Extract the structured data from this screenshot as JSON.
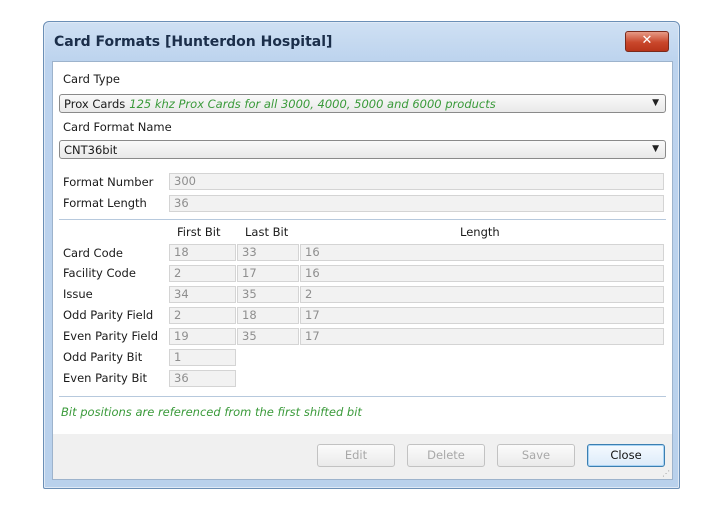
{
  "window": {
    "title": "Card Formats [Hunterdon Hospital]",
    "close_glyph": "✕"
  },
  "card_type": {
    "label": "Card Type",
    "value": "Prox Cards",
    "description": "125 khz Prox Cards for all 3000, 4000, 5000 and 6000 products"
  },
  "card_format_name": {
    "label": "Card Format Name",
    "value": "CNT36bit"
  },
  "format_number": {
    "label": "Format Number",
    "value": "300"
  },
  "format_length": {
    "label": "Format Length",
    "value": "36"
  },
  "columns": {
    "first_bit": "First Bit",
    "last_bit": "Last Bit",
    "length": "Length"
  },
  "rows": [
    {
      "label": "Card Code",
      "first": "18",
      "last": "33",
      "length": "16"
    },
    {
      "label": "Facility Code",
      "first": "2",
      "last": "17",
      "length": "16"
    },
    {
      "label": "Issue",
      "first": "34",
      "last": "35",
      "length": "2"
    },
    {
      "label": "Odd Parity Field",
      "first": "2",
      "last": "18",
      "length": "17"
    },
    {
      "label": "Even Parity Field",
      "first": "19",
      "last": "35",
      "length": "17"
    },
    {
      "label": "Odd Parity Bit",
      "first": "1"
    },
    {
      "label": "Even Parity Bit",
      "first": "36"
    }
  ],
  "note": "Bit positions are referenced from the first shifted bit",
  "buttons": {
    "edit": "Edit",
    "delete": "Delete",
    "save": "Save",
    "close": "Close"
  }
}
